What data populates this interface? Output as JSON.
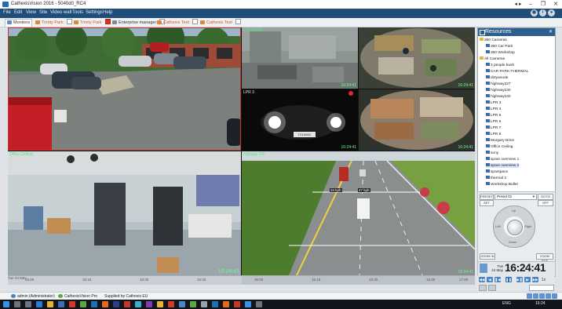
{
  "window": {
    "title": "CathexisVision 2016 - 5040d0_RC4",
    "controls": [
      "⎯",
      "❐",
      "✕"
    ],
    "extra": "◂ ▸"
  },
  "menu": {
    "items": [
      "File",
      "Edit",
      "View",
      "Site",
      "Video wall",
      "Tools",
      "Settings",
      "Help"
    ]
  },
  "tabs": [
    {
      "label": "Monitors"
    },
    {
      "label": "Trinity Park"
    },
    {
      "label": "Trinity Park"
    },
    {
      "label": "Enterprise manager"
    },
    {
      "label": "Cathexis Test"
    },
    {
      "label": "Cathexis Test"
    }
  ],
  "cameras": [
    {
      "label": "",
      "timestamp": ""
    },
    {
      "label": "CATHEXIS",
      "timestamp": "16:24:41"
    },
    {
      "label": "",
      "timestamp": "16:24:41"
    },
    {
      "label": "LPR 3",
      "timestamp": "16:24:41",
      "plate": "T2134SC"
    },
    {
      "label": "",
      "timestamp": "16:24:41"
    },
    {
      "label": "Office Ceiling",
      "timestamp": "16:24:41"
    },
    {
      "label": "highway 230",
      "timestamp": "16:24:41",
      "speed1": "34 kph",
      "speed2": "47 kph"
    }
  ],
  "timeline": {
    "range": "Tue 24 May",
    "ticks": [
      "15:00",
      "15:15",
      "15:30",
      "15:45",
      "16:00",
      "16:15",
      "16:30",
      "16:45",
      "17:00"
    ]
  },
  "resources": {
    "title": "Resources",
    "pin": "✕",
    "items": [
      {
        "label": "360 Cameras",
        "indent": 0,
        "kind": "folder"
      },
      {
        "label": "360 Car Park",
        "indent": 1,
        "kind": "cam"
      },
      {
        "label": "360 Workshop",
        "indent": 1,
        "kind": "cam"
      },
      {
        "label": "All Cameras",
        "indent": 0,
        "kind": "folder"
      },
      {
        "label": "2 people bush",
        "indent": 1,
        "kind": "cam"
      },
      {
        "label": "CAR PARK THERMAL",
        "indent": 1,
        "kind": "cam"
      },
      {
        "label": "dirtyanode",
        "indent": 1,
        "kind": "cam"
      },
      {
        "label": "highway227",
        "indent": 1,
        "kind": "cam"
      },
      {
        "label": "highway230",
        "indent": 1,
        "kind": "cam"
      },
      {
        "label": "highway240",
        "indent": 1,
        "kind": "cam"
      },
      {
        "label": "LPR 3",
        "indent": 1,
        "kind": "cam"
      },
      {
        "label": "LPR 4",
        "indent": 1,
        "kind": "cam"
      },
      {
        "label": "LPR 5",
        "indent": 1,
        "kind": "cam"
      },
      {
        "label": "LPR 6",
        "indent": 1,
        "kind": "cam"
      },
      {
        "label": "LPR 7",
        "indent": 1,
        "kind": "cam"
      },
      {
        "label": "LPR 8",
        "indent": 1,
        "kind": "cam"
      },
      {
        "label": "Morgary Drive",
        "indent": 1,
        "kind": "cam"
      },
      {
        "label": "Office Ceiling",
        "indent": 1,
        "kind": "cam"
      },
      {
        "label": "sony",
        "indent": 1,
        "kind": "cam"
      },
      {
        "label": "spare overview 1",
        "indent": 1,
        "kind": "cam"
      },
      {
        "label": "spare overview 2",
        "indent": 1,
        "kind": "cam",
        "selected": true
      },
      {
        "label": "sparspace",
        "indent": 1,
        "kind": "cam"
      },
      {
        "label": "thermal 2",
        "indent": 1,
        "kind": "cam"
      },
      {
        "label": "Workshop Bullet",
        "indent": 1,
        "kind": "cam"
      }
    ]
  },
  "ptz": {
    "left_button": "PRESET",
    "preset": "Preset 01",
    "go_button": "GOTO",
    "set_button": "SET",
    "off_button": "OFF",
    "zoom_in": "ZOOM IN",
    "zoom_out": "ZOOM OUT",
    "wheel_labels": [
      "Up",
      "Down",
      "Left",
      "Right"
    ]
  },
  "clock": {
    "day": "Tue",
    "date": "24 May",
    "time": "16:24:41"
  },
  "playback": {
    "buttons": [
      "◀◀",
      "◀",
      "❚◀",
      "❚❚",
      "▶❚",
      "▶",
      "▶▶"
    ],
    "speed": "1x"
  },
  "status": {
    "user": "admin (Administrator)",
    "product": "CathexisVision Pro",
    "supplied": "Supplied by Cathexis EU"
  },
  "taskbar": {
    "tray_text": "ENG",
    "clock": "16:24"
  },
  "colors": {
    "menubar": "#1f4e7a",
    "accent_orange": "#e0531f",
    "overlay_green": "#4df07a"
  }
}
